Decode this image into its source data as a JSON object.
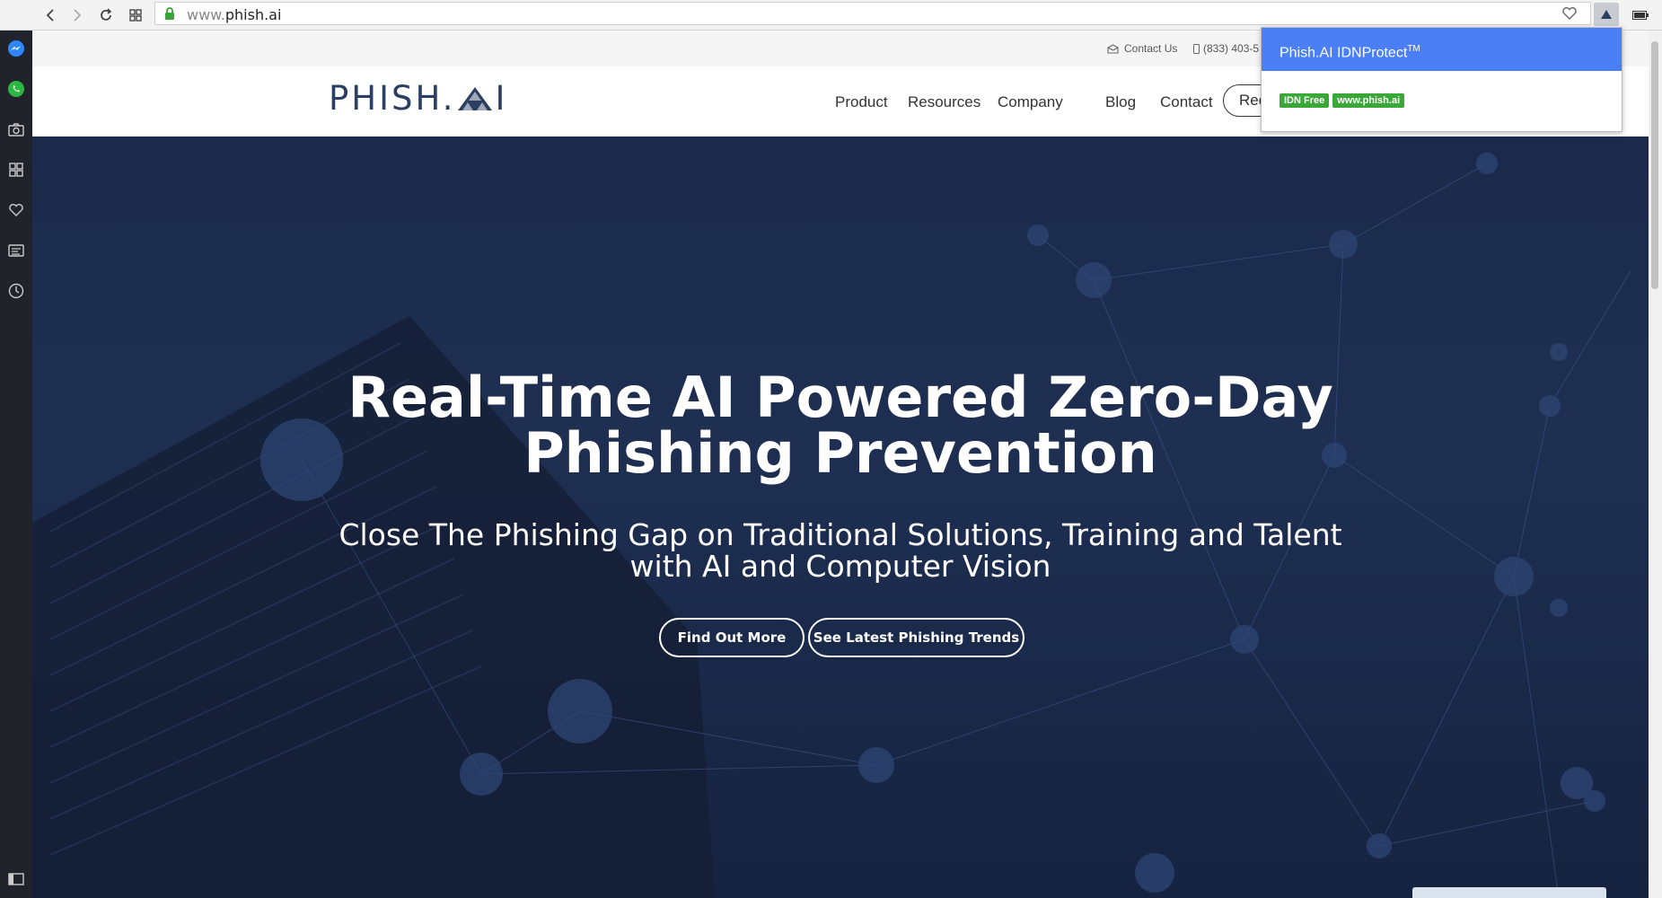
{
  "browser": {
    "url_prefix": "www.",
    "url_domain": "phish.ai"
  },
  "topbar": {
    "contact_us": "Contact Us",
    "phone": "(833) 403-5"
  },
  "header": {
    "logo_text_left": "PHISH.",
    "logo_text_right": "I",
    "menu": [
      "Product",
      "Resources",
      "Company",
      "Blog",
      "Contact"
    ],
    "request_button": "Req"
  },
  "hero": {
    "title_line1": "Real-Time AI Powered Zero-Day",
    "title_line2": "Phishing Prevention",
    "subtitle_line1": "Close The Phishing Gap on Traditional Solutions, Training and Talent",
    "subtitle_line2": "with AI and Computer Vision",
    "button_primary": "Find Out More",
    "button_secondary": "See Latest Phishing Trends"
  },
  "popup": {
    "title": "Phish.AI IDNProtect",
    "title_sup": "TM",
    "badge_status": "IDN Free",
    "badge_domain": "www.phish.ai"
  },
  "colors": {
    "hero_bg": "#1c2740",
    "logo": "#2b3f63",
    "popup_header": "#4a7ff6",
    "badge": "#39a837"
  }
}
